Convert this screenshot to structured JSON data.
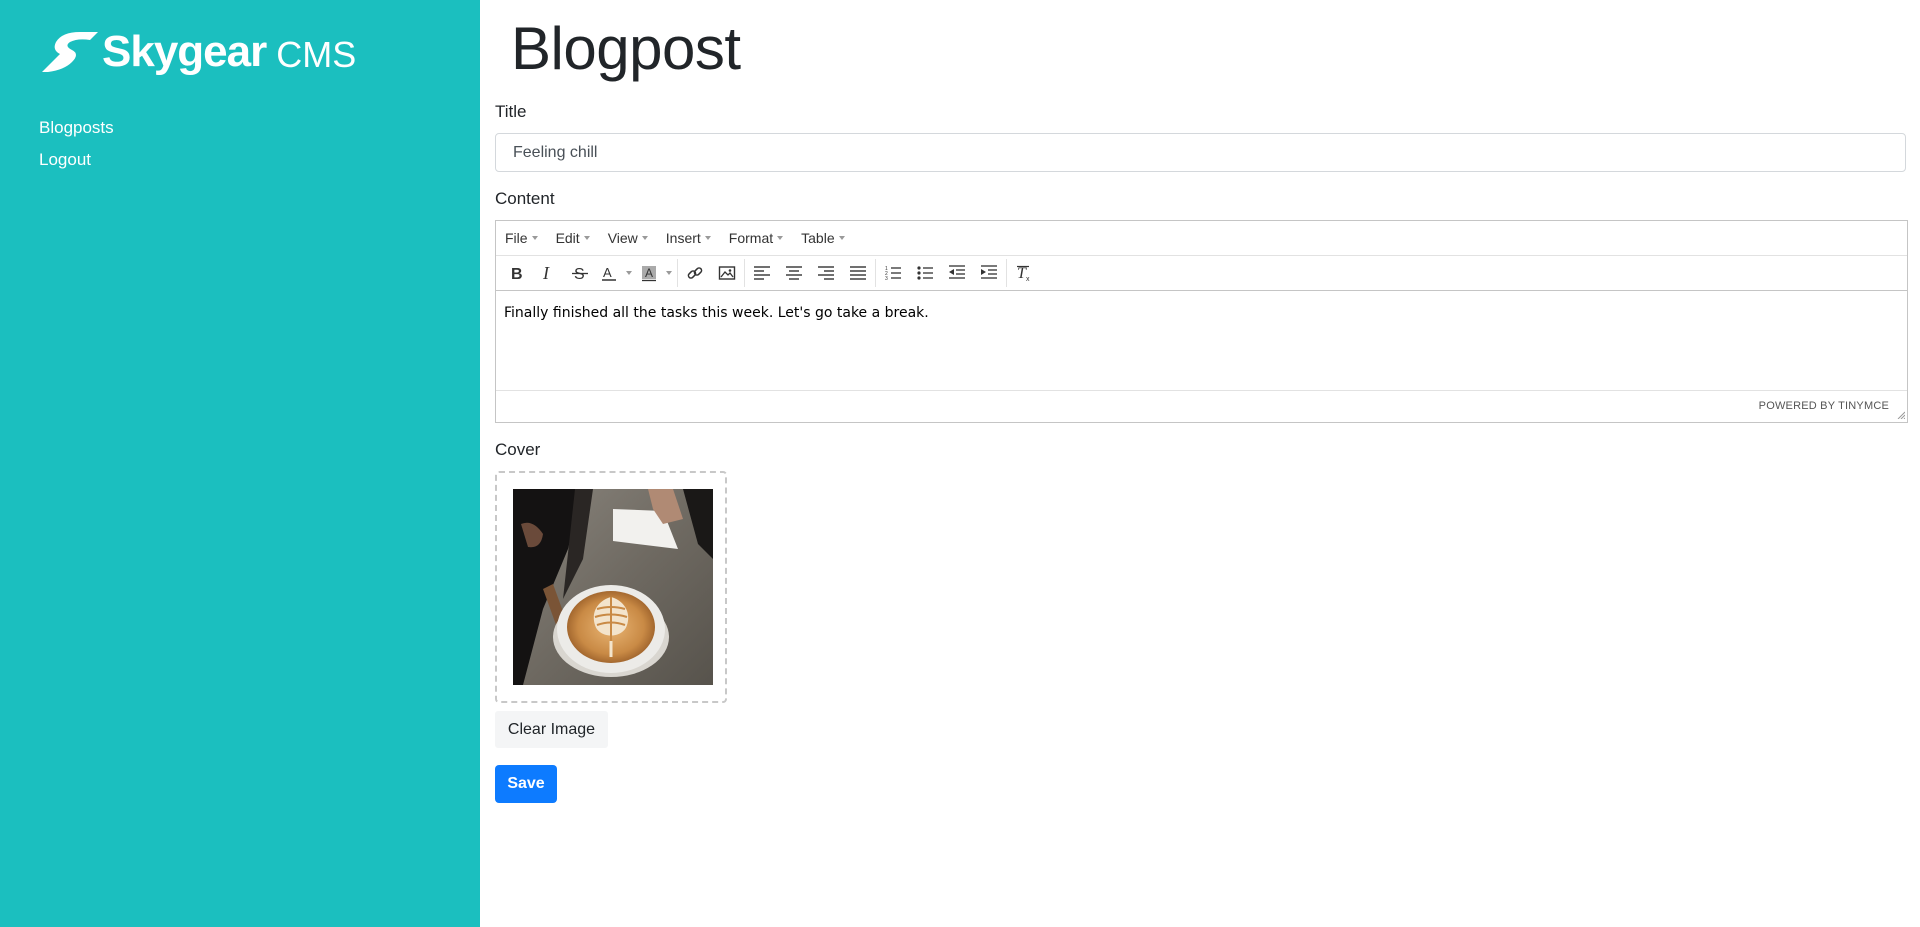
{
  "sidebar": {
    "brand": "Skygear",
    "brand_suffix": "CMS",
    "nav": [
      {
        "label": "Blogposts"
      },
      {
        "label": "Logout"
      }
    ],
    "bg_color": "#1bbfbf"
  },
  "main": {
    "page_title": "Blogpost",
    "title_label": "Title",
    "title_value": "Feeling chill",
    "content_label": "Content",
    "editor": {
      "menus": [
        {
          "label": "File"
        },
        {
          "label": "Edit"
        },
        {
          "label": "View"
        },
        {
          "label": "Insert"
        },
        {
          "label": "Format"
        },
        {
          "label": "Table"
        }
      ],
      "toolbar_icons": [
        "bold-icon",
        "italic-icon",
        "strikethrough-icon",
        "text-color-icon",
        "background-color-icon",
        "link-icon",
        "image-icon",
        "align-left-icon",
        "align-center-icon",
        "align-right-icon",
        "align-justify-icon",
        "numbered-list-icon",
        "bullet-list-icon",
        "outdent-icon",
        "indent-icon",
        "clear-formatting-icon"
      ],
      "body_text": "Finally finished all the tasks this week. Let's go take a break.",
      "powered_by": "POWERED BY TINYMCE"
    },
    "cover_label": "Cover",
    "cover_image": "latte-art-coffee-photo",
    "clear_image_label": "Clear Image",
    "save_label": "Save",
    "accent_color": "#0d7bff"
  }
}
